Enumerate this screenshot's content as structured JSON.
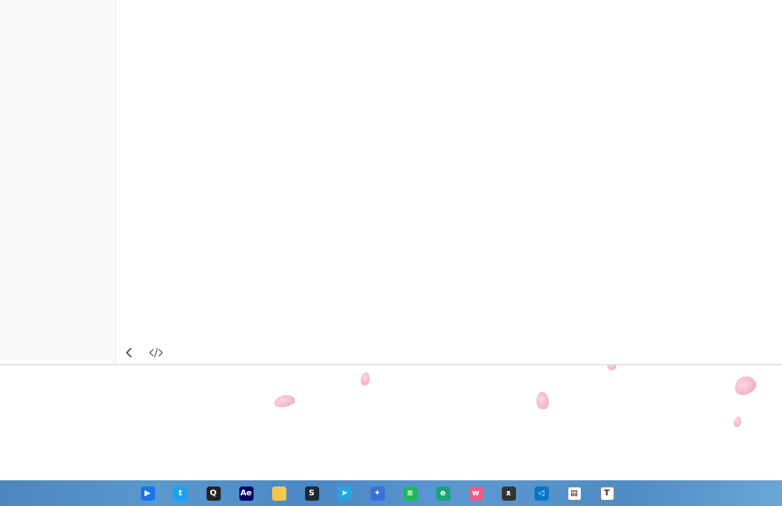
{
  "window": {
    "status_bar": {
      "back_icon": "chevron-left-icon",
      "source_icon": "code-icon"
    }
  },
  "desktop": {
    "theme": "cherry-blossom petals",
    "petal_color": "#f3a9bd"
  },
  "taskbar": {
    "apps": [
      {
        "name": "bilibili-like-app",
        "icon": "play-icon",
        "color": "#1a73e8",
        "glyph": "▶"
      },
      {
        "name": "twitter",
        "icon": "bird-icon",
        "color": "#1da1f2",
        "glyph": "t"
      },
      {
        "name": "qq",
        "icon": "penguin-icon",
        "color": "#222222",
        "glyph": "Q"
      },
      {
        "name": "after-effects",
        "icon": "ae-icon",
        "color": "#00005b",
        "glyph": "Ae"
      },
      {
        "name": "file-explorer",
        "icon": "folder-icon",
        "color": "#f2c94c",
        "glyph": ""
      },
      {
        "name": "steam",
        "icon": "steam-icon",
        "color": "#1b2838",
        "glyph": "S"
      },
      {
        "name": "telegram",
        "icon": "paper-plane-icon",
        "color": "#2aa3e0",
        "glyph": "➤"
      },
      {
        "name": "bird-app",
        "icon": "swallow-icon",
        "color": "#3a6fd8",
        "glyph": "✦"
      },
      {
        "name": "spotify",
        "icon": "spotify-icon",
        "color": "#1db954",
        "glyph": "≋"
      },
      {
        "name": "edge",
        "icon": "edge-icon",
        "color": "#1aa37a",
        "glyph": "e"
      },
      {
        "name": "pink-app",
        "icon": "pink-app-icon",
        "color": "#f05a8b",
        "glyph": "w"
      },
      {
        "name": "cat-app",
        "icon": "cat-icon",
        "color": "#333333",
        "glyph": "ᴥ"
      },
      {
        "name": "vscode",
        "icon": "vscode-icon",
        "color": "#0a74c9",
        "glyph": "◁"
      },
      {
        "name": "news-app",
        "icon": "news-icon",
        "color": "#ffffff",
        "glyph": "▤"
      },
      {
        "name": "typora",
        "icon": "typora-icon",
        "color": "#ffffff",
        "glyph": "T"
      }
    ]
  }
}
